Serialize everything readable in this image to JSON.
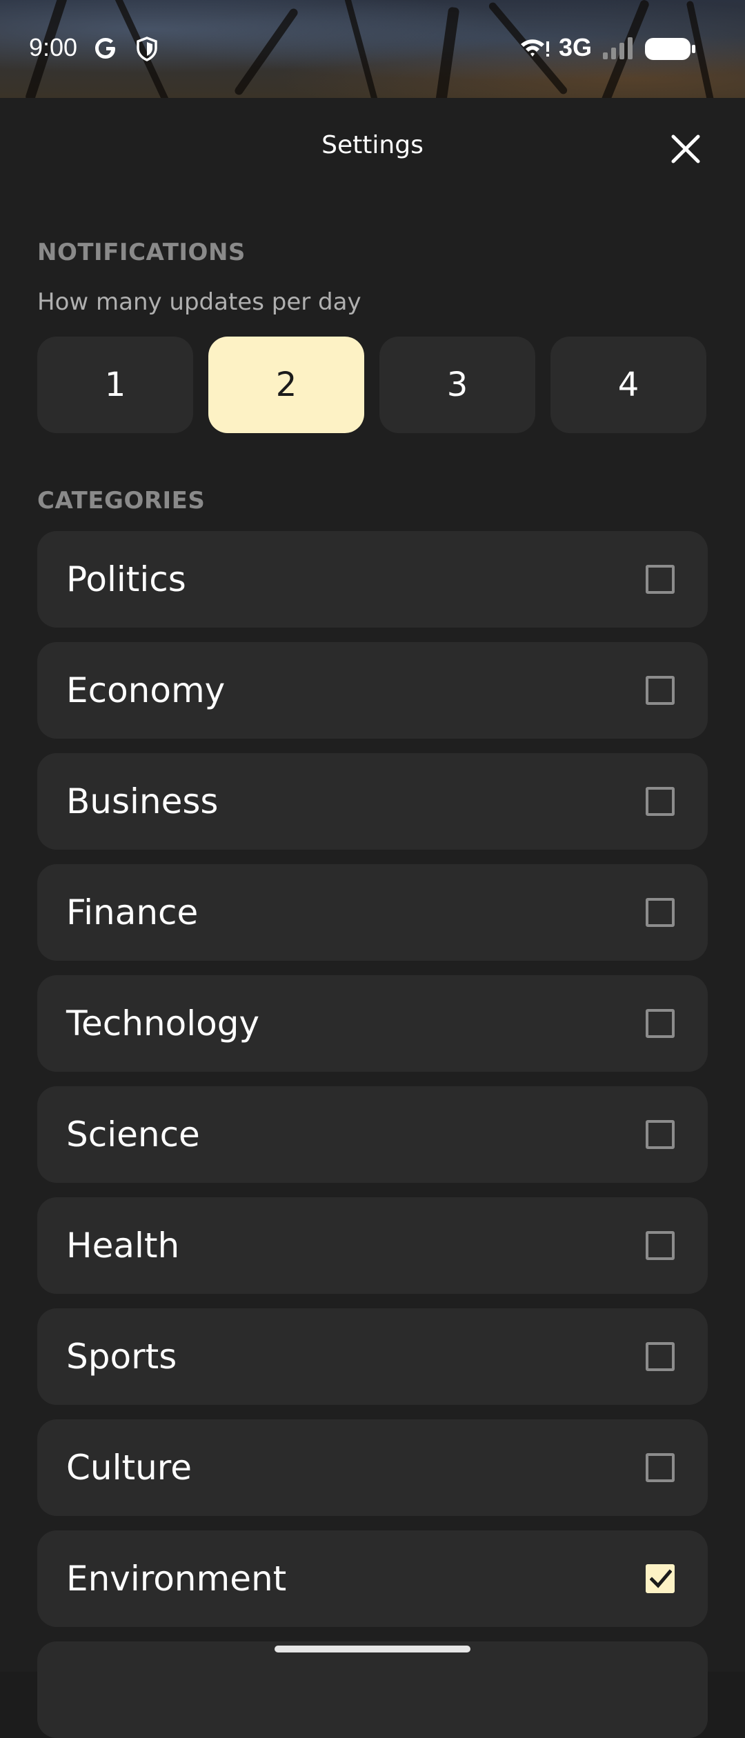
{
  "status_bar": {
    "time": "9:00",
    "network": "3G",
    "icons": [
      "google-icon",
      "shield-icon",
      "wifi-icon",
      "signal-icon",
      "battery-icon"
    ]
  },
  "header": {
    "title": "Settings",
    "close_icon": "close-icon"
  },
  "notifications": {
    "section_label": "NOTIFICATIONS",
    "subtitle": "How many updates per day",
    "options": [
      "1",
      "2",
      "3",
      "4"
    ],
    "selected": "2"
  },
  "categories": {
    "section_label": "CATEGORIES",
    "items": [
      {
        "label": "Politics",
        "checked": false
      },
      {
        "label": "Economy",
        "checked": false
      },
      {
        "label": "Business",
        "checked": false
      },
      {
        "label": "Finance",
        "checked": false
      },
      {
        "label": "Technology",
        "checked": false
      },
      {
        "label": "Science",
        "checked": false
      },
      {
        "label": "Health",
        "checked": false
      },
      {
        "label": "Sports",
        "checked": false
      },
      {
        "label": "Culture",
        "checked": false
      },
      {
        "label": "Environment",
        "checked": true
      }
    ]
  },
  "colors": {
    "accent": "#fdf2c5",
    "background": "#1f1f1f",
    "card": "#2b2b2b",
    "section_label": "#8a8a8a"
  }
}
